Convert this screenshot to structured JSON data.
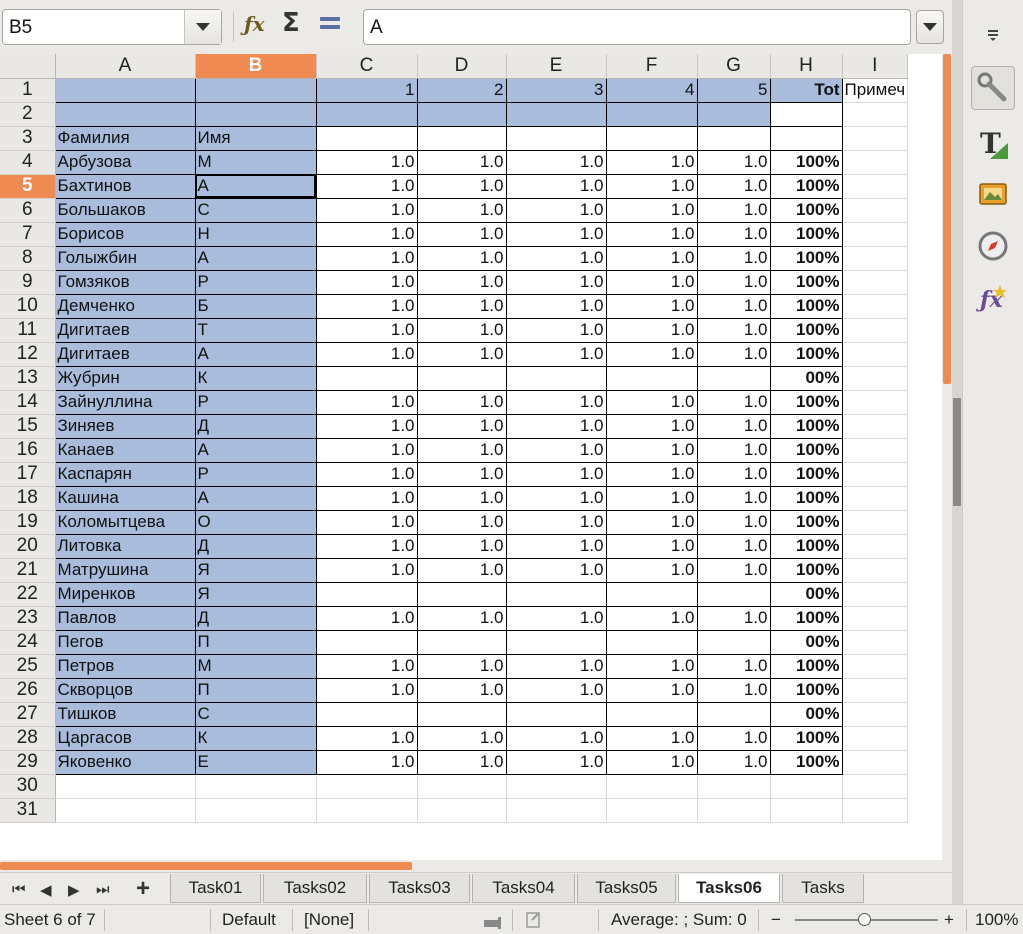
{
  "formula_bar": {
    "cell_reference": "B5",
    "formula_value": "A",
    "icons": [
      "function-wizard-icon",
      "sum-icon",
      "formula-icon"
    ]
  },
  "columns": [
    "A",
    "B",
    "C",
    "D",
    "E",
    "F",
    "G",
    "H",
    "I"
  ],
  "selected_column": "B",
  "selected_row": 5,
  "rows": [
    {
      "n": "1",
      "a": "",
      "b": "",
      "c": "1",
      "d": "2",
      "e": "3",
      "f": "4",
      "g": "5",
      "h": "Tot",
      "i": "Примеч"
    },
    {
      "n": "2",
      "a": "",
      "b": "",
      "c": "",
      "d": "",
      "e": "",
      "f": "",
      "g": "",
      "h": "",
      "i": ""
    },
    {
      "n": "3",
      "a": "Фамилия",
      "b": "Имя",
      "c": "",
      "d": "",
      "e": "",
      "f": "",
      "g": "",
      "h": "",
      "i": ""
    },
    {
      "n": "4",
      "a": "Арбузова",
      "b": "М",
      "c": "1.0",
      "d": "1.0",
      "e": "1.0",
      "f": "1.0",
      "g": "1.0",
      "h": "100%",
      "i": ""
    },
    {
      "n": "5",
      "a": "Бахтинов",
      "b": "А",
      "c": "1.0",
      "d": "1.0",
      "e": "1.0",
      "f": "1.0",
      "g": "1.0",
      "h": "100%",
      "i": ""
    },
    {
      "n": "6",
      "a": "Большаков",
      "b": "С",
      "c": "1.0",
      "d": "1.0",
      "e": "1.0",
      "f": "1.0",
      "g": "1.0",
      "h": "100%",
      "i": ""
    },
    {
      "n": "7",
      "a": "Борисов",
      "b": "Н",
      "c": "1.0",
      "d": "1.0",
      "e": "1.0",
      "f": "1.0",
      "g": "1.0",
      "h": "100%",
      "i": ""
    },
    {
      "n": "8",
      "a": "Голыжбин",
      "b": "А",
      "c": "1.0",
      "d": "1.0",
      "e": "1.0",
      "f": "1.0",
      "g": "1.0",
      "h": "100%",
      "i": ""
    },
    {
      "n": "9",
      "a": "Гомзяков",
      "b": "Р",
      "c": "1.0",
      "d": "1.0",
      "e": "1.0",
      "f": "1.0",
      "g": "1.0",
      "h": "100%",
      "i": ""
    },
    {
      "n": "10",
      "a": "Демченко",
      "b": "Б",
      "c": "1.0",
      "d": "1.0",
      "e": "1.0",
      "f": "1.0",
      "g": "1.0",
      "h": "100%",
      "i": ""
    },
    {
      "n": "11",
      "a": "Дигитаев",
      "b": "Т",
      "c": "1.0",
      "d": "1.0",
      "e": "1.0",
      "f": "1.0",
      "g": "1.0",
      "h": "100%",
      "i": ""
    },
    {
      "n": "12",
      "a": "Дигитаев",
      "b": "А",
      "c": "1.0",
      "d": "1.0",
      "e": "1.0",
      "f": "1.0",
      "g": "1.0",
      "h": "100%",
      "i": ""
    },
    {
      "n": "13",
      "a": "Жубрин",
      "b": "К",
      "c": "",
      "d": "",
      "e": "",
      "f": "",
      "g": "",
      "h": "00%",
      "i": ""
    },
    {
      "n": "14",
      "a": "Зайнуллина",
      "b": "Р",
      "c": "1.0",
      "d": "1.0",
      "e": "1.0",
      "f": "1.0",
      "g": "1.0",
      "h": "100%",
      "i": ""
    },
    {
      "n": "15",
      "a": "Зиняев",
      "b": "Д",
      "c": "1.0",
      "d": "1.0",
      "e": "1.0",
      "f": "1.0",
      "g": "1.0",
      "h": "100%",
      "i": ""
    },
    {
      "n": "16",
      "a": "Канаев",
      "b": "А",
      "c": "1.0",
      "d": "1.0",
      "e": "1.0",
      "f": "1.0",
      "g": "1.0",
      "h": "100%",
      "i": ""
    },
    {
      "n": "17",
      "a": "Каспарян",
      "b": "Р",
      "c": "1.0",
      "d": "1.0",
      "e": "1.0",
      "f": "1.0",
      "g": "1.0",
      "h": "100%",
      "i": ""
    },
    {
      "n": "18",
      "a": "Кашина",
      "b": "А",
      "c": "1.0",
      "d": "1.0",
      "e": "1.0",
      "f": "1.0",
      "g": "1.0",
      "h": "100%",
      "i": ""
    },
    {
      "n": "19",
      "a": "Коломытцева",
      "b": "О",
      "c": "1.0",
      "d": "1.0",
      "e": "1.0",
      "f": "1.0",
      "g": "1.0",
      "h": "100%",
      "i": ""
    },
    {
      "n": "20",
      "a": "Литовка",
      "b": "Д",
      "c": "1.0",
      "d": "1.0",
      "e": "1.0",
      "f": "1.0",
      "g": "1.0",
      "h": "100%",
      "i": ""
    },
    {
      "n": "21",
      "a": "Матрушина",
      "b": "Я",
      "c": "1.0",
      "d": "1.0",
      "e": "1.0",
      "f": "1.0",
      "g": "1.0",
      "h": "100%",
      "i": ""
    },
    {
      "n": "22",
      "a": "Миренков",
      "b": "Я",
      "c": "",
      "d": "",
      "e": "",
      "f": "",
      "g": "",
      "h": "00%",
      "i": ""
    },
    {
      "n": "23",
      "a": "Павлов",
      "b": "Д",
      "c": "1.0",
      "d": "1.0",
      "e": "1.0",
      "f": "1.0",
      "g": "1.0",
      "h": "100%",
      "i": ""
    },
    {
      "n": "24",
      "a": "Пегов",
      "b": "П",
      "c": "",
      "d": "",
      "e": "",
      "f": "",
      "g": "",
      "h": "00%",
      "i": ""
    },
    {
      "n": "25",
      "a": "Петров",
      "b": "М",
      "c": "1.0",
      "d": "1.0",
      "e": "1.0",
      "f": "1.0",
      "g": "1.0",
      "h": "100%",
      "i": ""
    },
    {
      "n": "26",
      "a": "Скворцов",
      "b": "П",
      "c": "1.0",
      "d": "1.0",
      "e": "1.0",
      "f": "1.0",
      "g": "1.0",
      "h": "100%",
      "i": ""
    },
    {
      "n": "27",
      "a": "Тишков",
      "b": "С",
      "c": "",
      "d": "",
      "e": "",
      "f": "",
      "g": "",
      "h": "00%",
      "i": ""
    },
    {
      "n": "28",
      "a": "Царгасов",
      "b": "К",
      "c": "1.0",
      "d": "1.0",
      "e": "1.0",
      "f": "1.0",
      "g": "1.0",
      "h": "100%",
      "i": ""
    },
    {
      "n": "29",
      "a": "Яковенко",
      "b": "Е",
      "c": "1.0",
      "d": "1.0",
      "e": "1.0",
      "f": "1.0",
      "g": "1.0",
      "h": "100%",
      "i": ""
    },
    {
      "n": "30",
      "a": "",
      "b": "",
      "c": "",
      "d": "",
      "e": "",
      "f": "",
      "g": "",
      "h": "",
      "i": ""
    },
    {
      "n": "31",
      "a": "",
      "b": "",
      "c": "",
      "d": "",
      "e": "",
      "f": "",
      "g": "",
      "h": "",
      "i": ""
    }
  ],
  "sheet_tabs": [
    "Task01",
    "Tasks02",
    "Tasks03",
    "Tasks04",
    "Tasks05",
    "Tasks06",
    "Tasks"
  ],
  "active_tab": "Tasks06",
  "sidebar": {
    "buttons": [
      "sidebar-menu-icon",
      "properties-icon",
      "styles-icon",
      "gallery-icon",
      "navigator-icon",
      "functions-icon"
    ]
  },
  "status_bar": {
    "sheet_position": "Sheet 6 of 7",
    "page_style": "Default",
    "language": "[None]",
    "selection_stats": "Average: ; Sum: 0",
    "zoom_minus": "−",
    "zoom_plus": "+",
    "zoom_level": "100%"
  },
  "colors": {
    "selection_accent": "#ef8b52",
    "cell_fill_blue": "#a9bcdc",
    "chrome_background": "#eceae6"
  }
}
